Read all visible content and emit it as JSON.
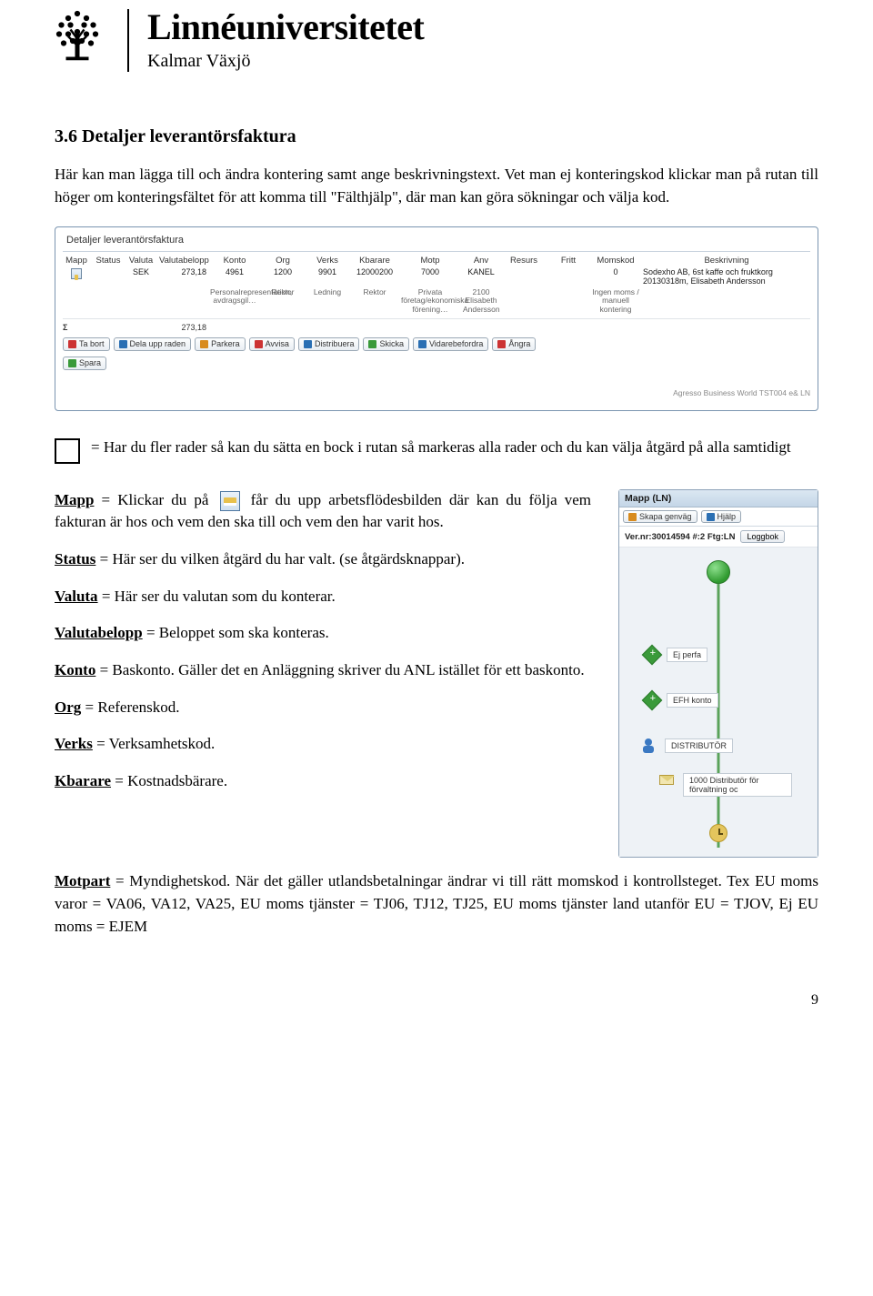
{
  "header": {
    "wordmark": "Linnéuniversitetet",
    "subtitle": "Kalmar Växjö"
  },
  "section": {
    "heading": "3.6 Detaljer leverantörsfaktura",
    "intro": "Här kan man lägga till och ändra kontering samt ange beskrivningstext. Vet man ej konteringskod klickar man på rutan till höger om konteringsfältet för att komma till \"Fälthjälp\", där man kan göra sökningar och välja kod."
  },
  "panel": {
    "title": "Detaljer leverantörsfaktura",
    "headers": [
      "Mapp",
      "Status",
      "Valuta",
      "Valutabelopp",
      "Konto",
      "Org",
      "Verks",
      "Kbarare",
      "Motp",
      "Anv",
      "Resurs",
      "Fritt",
      "Momskod",
      "Beskrivning"
    ],
    "row_values": [
      "",
      "",
      "SEK",
      "273,18",
      "4961",
      "1200",
      "9901",
      "12000200",
      "7000",
      "KANEL",
      "",
      "",
      "0",
      "Sodexho AB, 6st kaffe och fruktkorg 20130318m, Elisabeth Andersson"
    ],
    "row_subs": [
      "",
      "",
      "",
      "",
      "Personalrepresentation, avdragsgil…",
      "Rektor",
      "Ledning",
      "Rektor",
      "Privata företag/ekonomiska förening…",
      "2100 Elisabeth Andersson",
      "",
      "",
      "Ingen moms / manuell kontering",
      ""
    ],
    "sum": {
      "sigma": "Σ",
      "valutabelopp": "273,18"
    },
    "toolbar": [
      "Ta bort",
      "Dela upp raden",
      "Parkera",
      "Avvisa",
      "Distribuera",
      "Skicka",
      "Vidarebefordra",
      "Ångra"
    ],
    "spara": "Spara",
    "footer_text": "Agresso Business World   TST004   e&   LN"
  },
  "legend": {
    "text": "= Har du fler rader så kan du sätta en bock i rutan så markeras alla rader och du kan välja åtgärd på alla samtidigt"
  },
  "defs": {
    "mapp_prefix": "Mapp",
    "mapp_pre": " = Klickar du på ",
    "mapp_post": " får du upp arbetsflödesbilden där kan du följa vem fakturan är hos och vem den ska till och vem den har varit hos.",
    "status_label": "Status",
    "status_text": " = Här ser du vilken åtgärd du har valt. (se åtgärdsknappar).",
    "valuta_label": "Valuta",
    "valuta_text": " = Här ser du valutan som du konterar.",
    "valutabelopp_label": "Valutabelopp",
    "valutabelopp_text": " = Beloppet som ska konteras.",
    "konto_label": "Konto",
    "konto_text": " = Baskonto. Gäller det en Anläggning skriver du ANL istället för ett baskonto.",
    "org_label": "Org",
    "org_text": " = Referenskod.",
    "verks_label": "Verks",
    "verks_text": " = Verksamhetskod.",
    "kbarare_label": "Kbarare",
    "kbarare_text": " = Kostnadsbärare."
  },
  "workflow": {
    "title": "Mapp (LN)",
    "tb_skapa": "Skapa genväg",
    "tb_hjalp": "Hjälp",
    "meta": "Ver.nr:30014594 #:2 Ftg:LN",
    "loggbok": "Loggbok",
    "box_ej": "Ej perfa",
    "box_efh": "EFH konto",
    "box_dist": "DISTRIBUTÖR",
    "box_1000": "1000 Distributör för förvaltning oc"
  },
  "motpart": {
    "label": "Motpart",
    "text": " = Myndighetskod. När det gäller utlandsbetalningar ändrar vi till rätt momskod i kontrollsteget. Tex EU moms varor = VA06, VA12, VA25, EU moms tjänster = TJ06, TJ12, TJ25, EU moms tjänster land utanför EU = TJOV, Ej EU moms = EJEM"
  },
  "pagenum": "9"
}
